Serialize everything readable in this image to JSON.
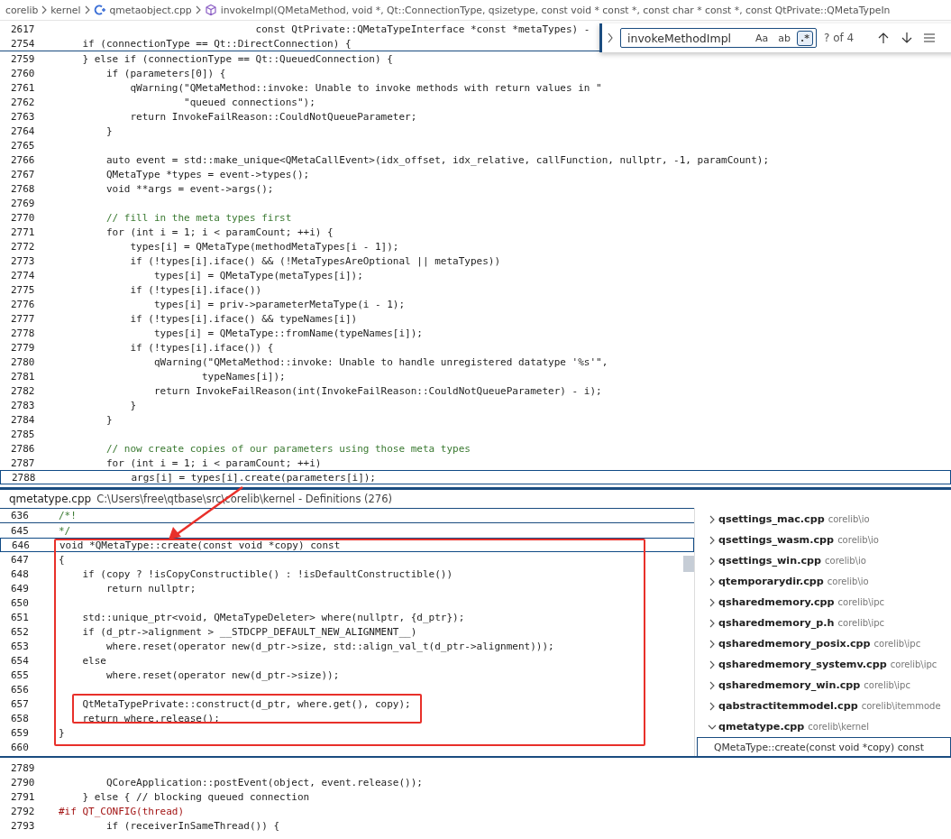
{
  "breadcrumb": {
    "items": [
      {
        "kind": "folder",
        "label": "corelib"
      },
      {
        "kind": "folder",
        "label": "kernel"
      },
      {
        "kind": "file",
        "label": "qmetaobject.cpp"
      },
      {
        "kind": "symbol",
        "label": "invokeImpl(QMetaMethod, void *, Qt::ConnectionType, qsizetype, const void * const *, const char * const *, const QtPrivate::QMetaTypeIn"
      }
    ]
  },
  "sticky_lines": [
    {
      "n": "2617",
      "kind": "code",
      "text": "                                 const QtPrivate::QMetaTypeInterface *const *metaTypes) -"
    },
    {
      "n": "2754",
      "kind": "code",
      "text": "    if (connectionType == Qt::DirectConnection) {"
    }
  ],
  "find_widget": {
    "value": "invokeMethodImpl",
    "toggles": [
      {
        "label": "Aa",
        "on": false
      },
      {
        "label": "ab",
        "on": false
      },
      {
        "label": ".*",
        "on": true
      }
    ],
    "count": "? of 4"
  },
  "editor_lines": [
    {
      "n": "2759",
      "kind": "code",
      "current": false,
      "text": "    } else if (connectionType == Qt::QueuedConnection) {"
    },
    {
      "n": "2760",
      "kind": "code",
      "current": false,
      "text": "        if (parameters[0]) {"
    },
    {
      "n": "2761",
      "kind": "code",
      "current": false,
      "text": "            qWarning(\"QMetaMethod::invoke: Unable to invoke methods with return values in \""
    },
    {
      "n": "2762",
      "kind": "code",
      "current": false,
      "text": "                     \"queued connections\");"
    },
    {
      "n": "2763",
      "kind": "code",
      "current": false,
      "text": "            return InvokeFailReason::CouldNotQueueParameter;"
    },
    {
      "n": "2764",
      "kind": "code",
      "current": false,
      "text": "        }"
    },
    {
      "n": "2765",
      "current": false
    },
    {
      "n": "2766",
      "kind": "code",
      "current": false,
      "text": "        auto event = std::make_unique<QMetaCallEvent>(idx_offset, idx_relative, callFunction, nullptr, -1, paramCount);"
    },
    {
      "n": "2767",
      "kind": "code",
      "current": false,
      "text": "        QMetaType *types = event->types();"
    },
    {
      "n": "2768",
      "kind": "code",
      "current": false,
      "text": "        void **args = event->args();"
    },
    {
      "n": "2769",
      "current": false
    },
    {
      "n": "2770",
      "kind": "comment",
      "current": false,
      "text": "        // fill in the meta types first"
    },
    {
      "n": "2771",
      "kind": "code",
      "current": false,
      "text": "        for (int i = 1; i < paramCount; ++i) {"
    },
    {
      "n": "2772",
      "kind": "code",
      "current": false,
      "text": "            types[i] = QMetaType(methodMetaTypes[i - 1]);"
    },
    {
      "n": "2773",
      "kind": "code",
      "current": false,
      "text": "            if (!types[i].iface() && (!MetaTypesAreOptional || metaTypes))"
    },
    {
      "n": "2774",
      "kind": "code",
      "current": false,
      "text": "                types[i] = QMetaType(metaTypes[i]);"
    },
    {
      "n": "2775",
      "kind": "code",
      "current": false,
      "text": "            if (!types[i].iface())"
    },
    {
      "n": "2776",
      "kind": "code",
      "current": false,
      "text": "                types[i] = priv->parameterMetaType(i - 1);"
    },
    {
      "n": "2777",
      "kind": "code",
      "current": false,
      "text": "            if (!types[i].iface() && typeNames[i])"
    },
    {
      "n": "2778",
      "kind": "code",
      "current": false,
      "text": "                types[i] = QMetaType::fromName(typeNames[i]);"
    },
    {
      "n": "2779",
      "kind": "code",
      "current": false,
      "text": "            if (!types[i].iface()) {"
    },
    {
      "n": "2780",
      "kind": "code",
      "current": false,
      "text": "                qWarning(\"QMetaMethod::invoke: Unable to handle unregistered datatype '%s'\","
    },
    {
      "n": "2781",
      "kind": "code",
      "current": false,
      "text": "                        typeNames[i]);"
    },
    {
      "n": "2782",
      "kind": "code",
      "current": false,
      "text": "                return InvokeFailReason(int(InvokeFailReason::CouldNotQueueParameter) - i);"
    },
    {
      "n": "2783",
      "kind": "code",
      "current": false,
      "text": "            }"
    },
    {
      "n": "2784",
      "kind": "code",
      "current": false,
      "text": "        }"
    },
    {
      "n": "2785",
      "current": false
    },
    {
      "n": "2786",
      "kind": "comment",
      "current": false,
      "text": "        // now create copies of our parameters using those meta types"
    },
    {
      "n": "2787",
      "kind": "code",
      "current": false,
      "text": "        for (int i = 1; i < paramCount; ++i)"
    },
    {
      "n": "2788",
      "kind": "code",
      "current": true,
      "text": "            args[i] = types[i].create(parameters[i]);"
    }
  ],
  "peek": {
    "file": "qmetatype.cpp",
    "path": "C:\\Users\\free\\qtbase\\src\\corelib\\kernel - Definitions (276)",
    "sticky_line": {
      "n": "636",
      "kind": "comment",
      "text": "/*!"
    },
    "lines": [
      {
        "n": "645",
        "kind": "comment",
        "current": false,
        "text": "*/"
      },
      {
        "n": "646",
        "kind": "code",
        "current": true,
        "text": "void *QMetaType::create(const void *copy) const"
      },
      {
        "n": "647",
        "kind": "code",
        "current": false,
        "text": "{"
      },
      {
        "n": "648",
        "kind": "code",
        "current": false,
        "text": "    if (copy ? !isCopyConstructible() : !isDefaultConstructible())"
      },
      {
        "n": "649",
        "kind": "code",
        "current": false,
        "text": "        return nullptr;"
      },
      {
        "n": "650",
        "current": false
      },
      {
        "n": "651",
        "kind": "code",
        "current": false,
        "text": "    std::unique_ptr<void, QMetaTypeDeleter> where(nullptr, {d_ptr});"
      },
      {
        "n": "652",
        "kind": "code",
        "current": false,
        "text": "    if (d_ptr->alignment > __STDCPP_DEFAULT_NEW_ALIGNMENT__)"
      },
      {
        "n": "653",
        "kind": "code",
        "current": false,
        "text": "        where.reset(operator new(d_ptr->size, std::align_val_t(d_ptr->alignment)));"
      },
      {
        "n": "654",
        "kind": "code",
        "current": false,
        "text": "    else"
      },
      {
        "n": "655",
        "kind": "code",
        "current": false,
        "text": "        where.reset(operator new(d_ptr->size));"
      },
      {
        "n": "656",
        "current": false
      },
      {
        "n": "657",
        "kind": "code",
        "current": false,
        "text": "    QtMetaTypePrivate::construct(d_ptr, where.get(), copy);"
      },
      {
        "n": "658",
        "kind": "code",
        "current": false,
        "text": "    return where.release();"
      },
      {
        "n": "659",
        "kind": "code",
        "current": false,
        "text": "}"
      },
      {
        "n": "660",
        "current": false
      }
    ],
    "results": [
      {
        "file": "qsettings_mac.cpp",
        "path": "corelib\\io",
        "expanded": false
      },
      {
        "file": "qsettings_wasm.cpp",
        "path": "corelib\\io",
        "expanded": false
      },
      {
        "file": "qsettings_win.cpp",
        "path": "corelib\\io",
        "expanded": false
      },
      {
        "file": "qtemporarydir.cpp",
        "path": "corelib\\io",
        "expanded": false
      },
      {
        "file": "qsharedmemory.cpp",
        "path": "corelib\\ipc",
        "expanded": false
      },
      {
        "file": "qsharedmemory_p.h",
        "path": "corelib\\ipc",
        "expanded": false
      },
      {
        "file": "qsharedmemory_posix.cpp",
        "path": "corelib\\ipc",
        "expanded": false
      },
      {
        "file": "qsharedmemory_systemv.cpp",
        "path": "corelib\\ipc",
        "expanded": false
      },
      {
        "file": "qsharedmemory_win.cpp",
        "path": "corelib\\ipc",
        "expanded": false
      },
      {
        "file": "qabstractitemmodel.cpp",
        "path": "corelib\\itemmode",
        "expanded": false
      },
      {
        "file": "qmetatype.cpp",
        "path": "corelib\\kernel",
        "expanded": true,
        "children": [
          {
            "label": "QMetaType::create(const void *copy) const",
            "selected": true
          }
        ]
      }
    ]
  },
  "bottom_lines": [
    {
      "n": "2789",
      "current": false
    },
    {
      "n": "2790",
      "kind": "code",
      "current": false,
      "text": "        QCoreApplication::postEvent(object, event.release());"
    },
    {
      "n": "2791",
      "kind": "code",
      "current": false,
      "text": "    } else { // blocking queued connection"
    },
    {
      "n": "2792",
      "kind": "preproc",
      "current": false,
      "text": "#if QT_CONFIG(thread)"
    },
    {
      "n": "2793",
      "kind": "code",
      "current": false,
      "text": "        if (receiverInSameThread()) {"
    }
  ]
}
